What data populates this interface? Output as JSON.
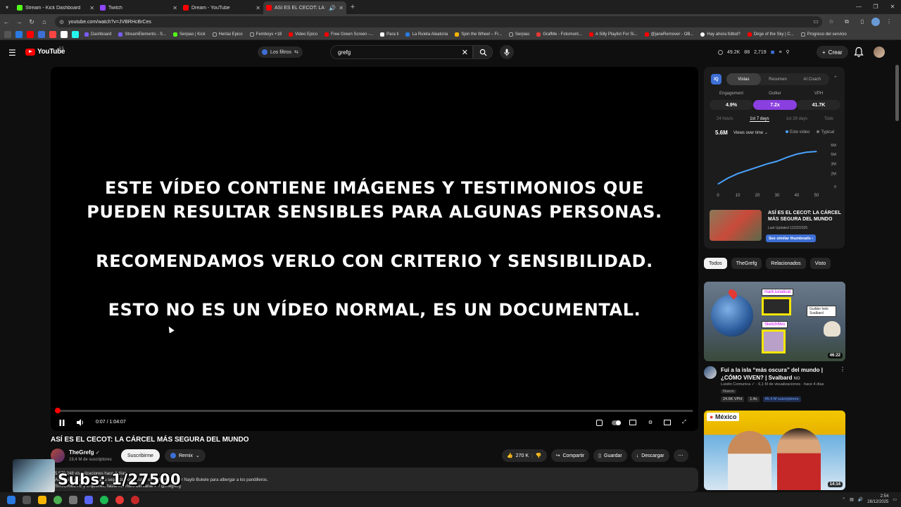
{
  "browser": {
    "tabs": [
      {
        "title": "Stream - Kick Dashboard",
        "color": "#53fc18",
        "active": false
      },
      {
        "title": "Twitch",
        "color": "#9146ff",
        "active": false
      },
      {
        "title": "Dream - YouTube",
        "color": "#ff0000",
        "active": false
      },
      {
        "title": "ASÍ ES EL CECOT: LA CÁRCEL",
        "color": "#ff0000",
        "active": true
      }
    ],
    "url": "youtube.com/watch?v=JVBRHcBrCes",
    "bookmarks": [
      {
        "label": "Dashboard",
        "color": "#7a5cff"
      },
      {
        "label": "StreamElements - S...",
        "color": "#7a5cff"
      },
      {
        "label": "Serpias | Kick",
        "color": "#53fc18"
      },
      {
        "label": "Hentai Epico",
        "color": "#aaaaaa"
      },
      {
        "label": "Femboys +18",
        "color": "#aaaaaa"
      },
      {
        "label": "Video Epico",
        "color": "#ff0000"
      },
      {
        "label": "Free Green Screen -...",
        "color": "#ff0000"
      },
      {
        "label": "Para ti",
        "color": "#ffffff"
      },
      {
        "label": "La Ruleta Aleatoria",
        "color": "#2a7ae2"
      },
      {
        "label": "Spin the Wheel – Fr...",
        "color": "#f5b400"
      },
      {
        "label": "Serpias",
        "color": "#aaaaaa"
      },
      {
        "label": "GrafMe - Fotomont...",
        "color": "#e53935"
      },
      {
        "label": "A Silly Playlist For Si...",
        "color": "#ff0000"
      },
      {
        "label": "@janeRemover - OB...",
        "color": "#ff0000"
      },
      {
        "label": "Hay ahora fútbol?",
        "color": "#ffffff"
      },
      {
        "label": "Dirge of the Sky | C...",
        "color": "#ff0000"
      },
      {
        "label": "Progreso del servicio",
        "color": "#aaaaaa"
      }
    ]
  },
  "header": {
    "logo_text": "YouTube",
    "country_code": "ES",
    "filters_label": "Los filtros",
    "search_value": "grefg",
    "stats": [
      "49.2K",
      "88",
      "2,719"
    ],
    "create_label": "Crear"
  },
  "player": {
    "warning_lines": [
      "ESTE VÍDEO CONTIENE IMÁGENES Y TESTIMONIOS QUE",
      "PUEDEN RESULTAR SENSIBLES PARA ALGUNAS PERSONAS.",
      "RECOMENDAMOS VERLO CON CRITERIO Y SENSIBILIDAD.",
      "ESTO NO ES UN VÍDEO NORMAL, ES UN DOCUMENTAL."
    ],
    "timecode": "0:07 / 1:04:07",
    "progress": 0.0018
  },
  "video": {
    "title": "ASÍ ES EL CECOT: LA CÁRCEL MÁS SEGURA DEL MUNDO",
    "channel": "TheGrefg",
    "subscribers": "19,4 M de suscriptores",
    "subscribe_label": "Suscribirme",
    "remix_label": "Remix",
    "likes": "270 K",
    "share_label": "Compartir",
    "save_label": "Guardar",
    "download_label": "Descargar",
    "description_line1": "5.570.248 visualizaciones  hace 4 días",
    "description_line2": "Así es la prisión de máxima seguridad construida en El Salvador por Nayib Bukele para albergar a los pandilleros.",
    "description_line3": "SUSCRÍBETE y si quieres, hazte miembro del canal  ✔ / @thegrefg"
  },
  "overlay": {
    "subs_text": "Subs: 1/27500"
  },
  "vidiq": {
    "logo": "IQ",
    "tabs": [
      "Vistas",
      "Resumen",
      "AI Coach"
    ],
    "metrics": [
      {
        "label": "Engagement",
        "value": "4.9%"
      },
      {
        "label": "Outlier",
        "value": "7.2x"
      },
      {
        "label": "VPH",
        "value": "41.7K"
      }
    ],
    "periods": [
      "24 hours",
      "1st 7 days",
      "1st 28 days",
      "Todo"
    ],
    "total_views": "5.6M",
    "dropdown_label": "Views over time",
    "legend": [
      "Este vídeo",
      "Typical"
    ],
    "video_title": "ASÍ ES EL CECOT: LA CÁRCEL MÁS SEGURA DEL MUNDO",
    "last_updated": "Last Updated 12/22/2025",
    "similar_label": "See similar thumbnails"
  },
  "chart_data": {
    "type": "line",
    "x_ticks": [
      "0",
      "10",
      "20",
      "30",
      "40",
      "50"
    ],
    "y_ticks": [
      "0",
      "2M",
      "3M",
      "5M",
      "6M"
    ],
    "series": [
      {
        "name": "Este vídeo",
        "x": [
          0,
          5,
          10,
          15,
          20,
          25,
          30,
          35,
          40,
          45,
          50
        ],
        "y": [
          0.4,
          1.3,
          2.0,
          2.5,
          3.0,
          3.5,
          3.9,
          4.5,
          5.0,
          5.3,
          5.4
        ]
      }
    ],
    "xlim": [
      0,
      50
    ],
    "ylim": [
      0,
      6.5
    ],
    "grid": false
  },
  "related": {
    "chips": [
      "Todos",
      "TheGrefg",
      "Relacionados",
      "Visto"
    ],
    "items": [
      {
        "title": "Fui a la isla “más oscura” del mundo | ¿CÓMO VIVEN? | Svalbard",
        "title_badge": "NO",
        "channel": "Luisito Comunica",
        "meta": "6,1 M de visualizaciones · hace 4 días",
        "badge": "Nuevo",
        "duration": "46:22",
        "stats": [
          "24.6K VPH",
          "1.4x",
          "45.4 M suscriptores"
        ],
        "thumb_tags": [
          "mark.lunaticat",
          "Sketch6lvo",
          "Guilder hele Svalbard"
        ]
      },
      {
        "label": "México",
        "duration": "14:14"
      }
    ]
  },
  "taskbar": {
    "time": "2:54",
    "date": "28/12/2025"
  }
}
